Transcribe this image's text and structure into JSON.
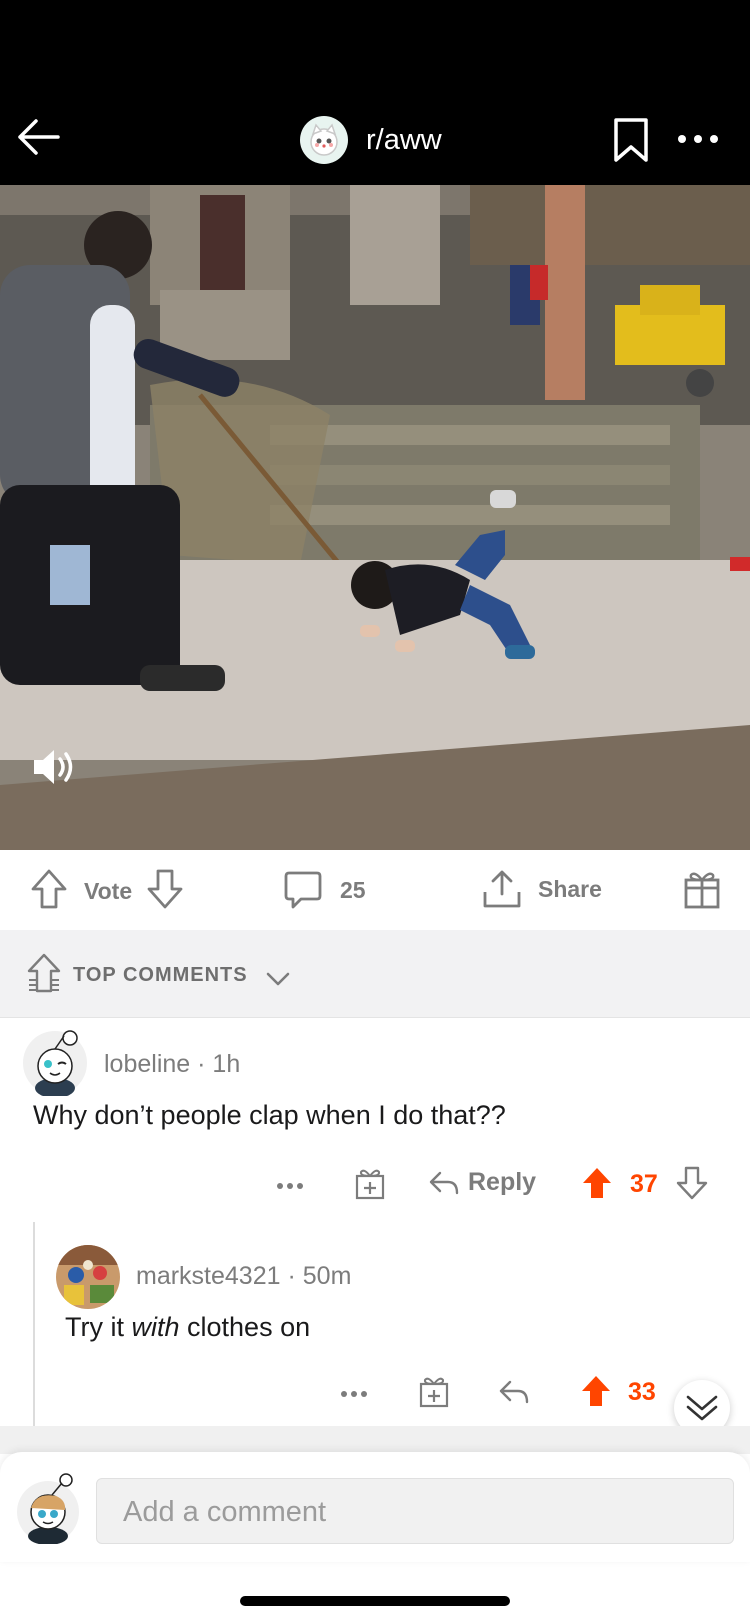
{
  "header": {
    "subreddit": "r/aww",
    "colors": {
      "bar": "#000000",
      "text": "#ffffff"
    },
    "icons": [
      "back-arrow-icon",
      "subreddit-avatar-icon",
      "bookmark-icon",
      "more-icon"
    ]
  },
  "video": {
    "icons": [
      "volume-icon"
    ]
  },
  "actions": {
    "vote_label": "Vote",
    "comment_count": "25",
    "share_label": "Share",
    "icons": [
      "upvote-icon",
      "downvote-icon",
      "comment-icon",
      "share-icon",
      "award-icon"
    ]
  },
  "sort": {
    "label": "TOP COMMENTS",
    "icons": [
      "sort-icon",
      "chevron-down-icon"
    ]
  },
  "comments": [
    {
      "user": "lobeline",
      "time": "1h",
      "body": "Why don’t people clap when I do that??",
      "reply_label": "Reply",
      "score": "37"
    },
    {
      "user": "markste4321",
      "time": "50m",
      "body_pre": "Try it ",
      "body_em": "with",
      "body_post": " clothes on",
      "score": "33"
    }
  ],
  "composer": {
    "placeholder": "Add a comment"
  },
  "accent_color": "#ff4500"
}
